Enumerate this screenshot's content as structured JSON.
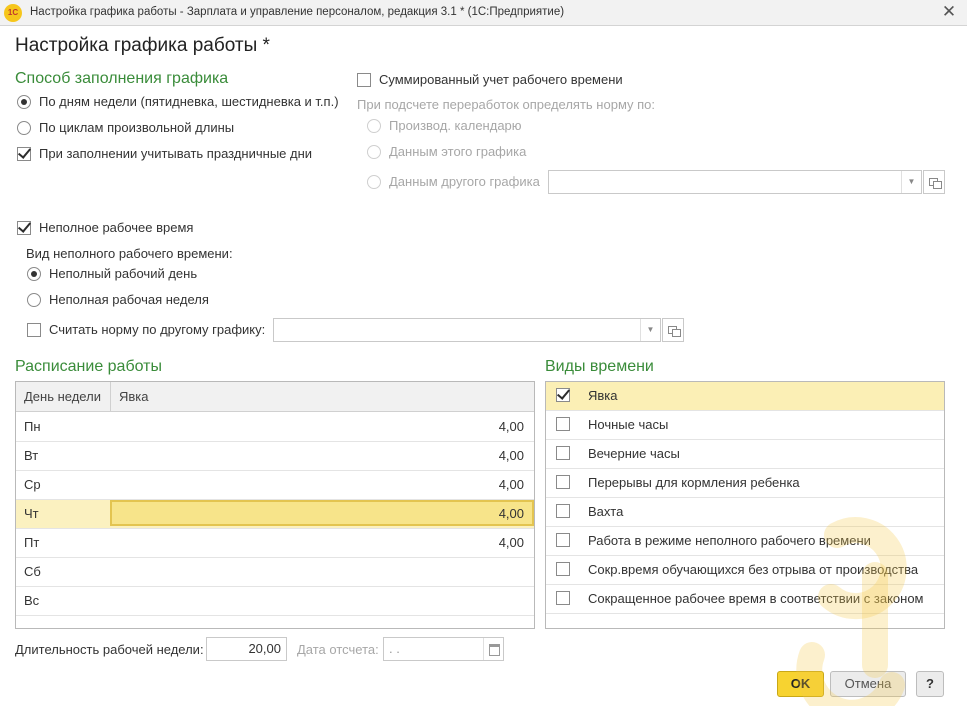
{
  "window": {
    "app_icon": "1c-logo",
    "logo_text": "1С",
    "title": "Настройка графика работы - Зарплата и управление персоналом, редакция 3.1 * (1С:Предприятие)",
    "close_icon": "close-icon",
    "close_glyph": "✕"
  },
  "form_title": "Настройка графика работы *",
  "fill": {
    "title": "Способ заполнения графика",
    "by_weekdays": "По дням недели (пятидневка, шестидневка и т.п.)",
    "by_cycles": "По циклам произвольной длины",
    "holidays": "При заполнении учитывать праздничные дни",
    "selected": "by_weekdays",
    "holidays_checked": true
  },
  "summarized": {
    "label": "Суммированный учет рабочего времени",
    "checked": false,
    "norm_caption": "При подсчете переработок определять норму по:",
    "options": [
      "Производ. календарю",
      "Данным этого графика",
      "Данным другого графика"
    ],
    "other_graph_value": ""
  },
  "parttime": {
    "label": "Неполное рабочее время",
    "checked": true,
    "kind_caption": "Вид неполного рабочего времени:",
    "options": [
      "Неполный рабочий день",
      "Неполная рабочая неделя"
    ],
    "selected": 0,
    "other_norm_label": "Считать норму по другому графику:",
    "other_norm_checked": false,
    "other_norm_value": ""
  },
  "schedule": {
    "title": "Расписание работы",
    "col_day": "День недели",
    "col_attendance": "Явка",
    "rows": [
      {
        "day": "Пн",
        "value": "4,00"
      },
      {
        "day": "Вт",
        "value": "4,00"
      },
      {
        "day": "Ср",
        "value": "4,00"
      },
      {
        "day": "Чт",
        "value": "4,00"
      },
      {
        "day": "Пт",
        "value": "4,00"
      },
      {
        "day": "Сб",
        "value": ""
      },
      {
        "day": "Вс",
        "value": ""
      }
    ],
    "selected_row": 3
  },
  "time_types": {
    "title": "Виды времени",
    "items": [
      {
        "label": "Явка",
        "checked": true
      },
      {
        "label": "Ночные часы",
        "checked": false
      },
      {
        "label": "Вечерние часы",
        "checked": false
      },
      {
        "label": "Перерывы для кормления ребенка",
        "checked": false
      },
      {
        "label": "Вахта",
        "checked": false
      },
      {
        "label": "Работа в режиме неполного рабочего времени",
        "checked": false
      },
      {
        "label": "Сокр.время обучающихся без отрыва от производства",
        "checked": false
      },
      {
        "label": "Сокращенное рабочее время в соответствии с законом",
        "checked": false
      }
    ],
    "selected_row": 0
  },
  "footer": {
    "week_length_label": "Длительность рабочей недели:",
    "week_length_value": "20,00",
    "ref_date_label": "Дата отсчета:",
    "ref_date_value": " .  .",
    "ok": "OK",
    "cancel": "Отмена",
    "help": "?"
  },
  "colors": {
    "section_title": "#3a8c3a",
    "ok_button": "#f7d330",
    "selection": "#f7e48a"
  }
}
